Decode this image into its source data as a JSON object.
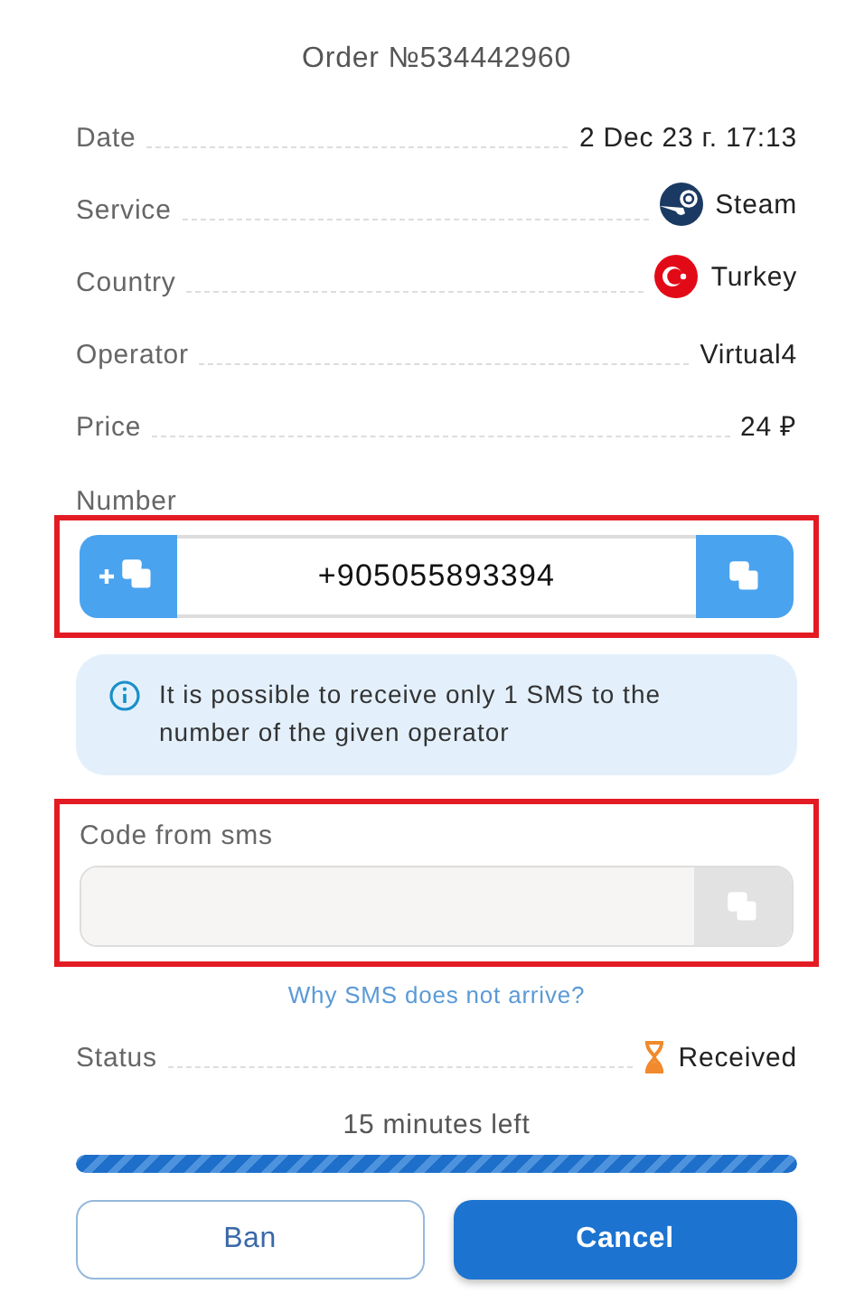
{
  "title": "Order №534442960",
  "details": [
    {
      "label": "Date",
      "value": "2 Dec 23 г. 17:13",
      "kind": "plain"
    },
    {
      "label": "Service",
      "value": "Steam",
      "kind": "service"
    },
    {
      "label": "Country",
      "value": "Turkey",
      "kind": "country"
    },
    {
      "label": "Operator",
      "value": "Virtual4",
      "kind": "plain"
    },
    {
      "label": "Price",
      "value": "24 ₽",
      "kind": "plain"
    }
  ],
  "number": {
    "label": "Number",
    "value": "+905055893394",
    "highlighted": true
  },
  "notice": "It is possible to receive only 1 SMS to the number of the given operator",
  "code": {
    "label": "Code from sms",
    "highlighted": true,
    "disabled": true
  },
  "help_link": "Why SMS does not arrive?",
  "status": {
    "label": "Status",
    "value": "Received",
    "kind": "waiting"
  },
  "timer": {
    "text": "15 minutes left",
    "level": 1.0
  },
  "buttons": [
    {
      "label": "Ban",
      "kind": "outline"
    },
    {
      "label": "Cancel",
      "kind": "primary"
    }
  ]
}
